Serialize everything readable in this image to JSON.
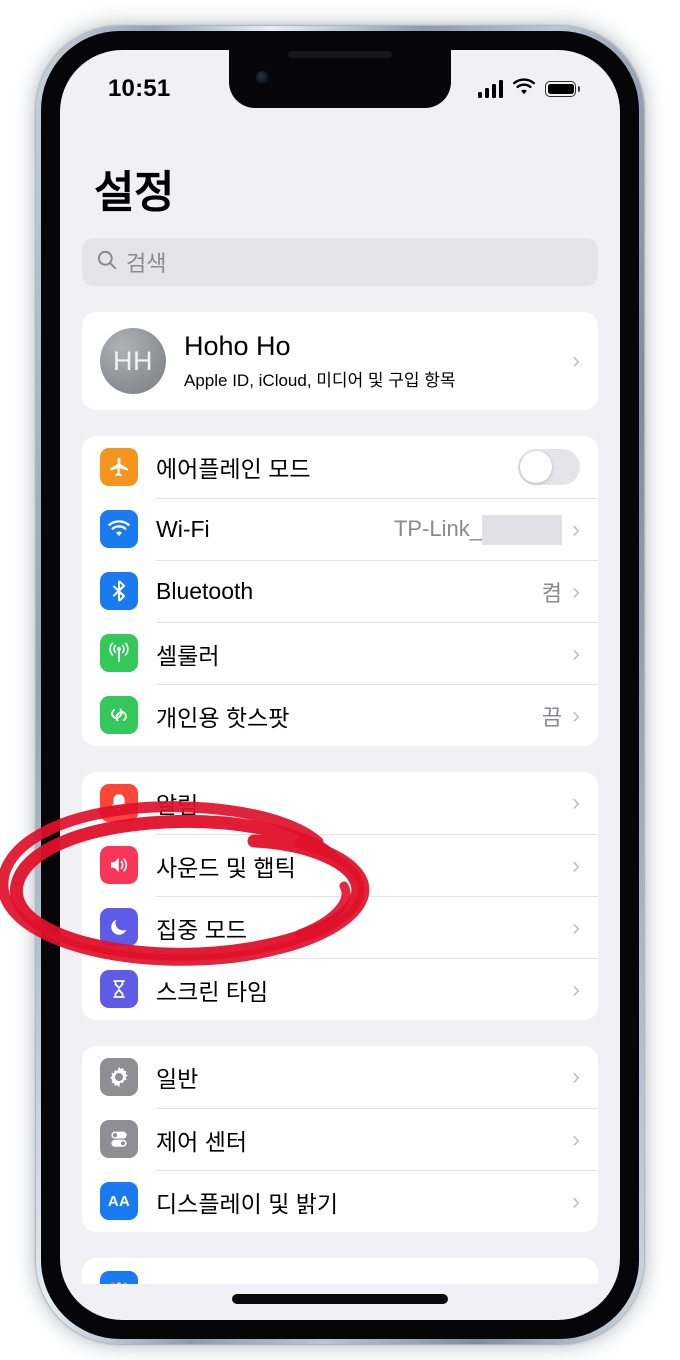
{
  "status_bar": {
    "time": "10:51",
    "signal_icon": "cellular-bars-icon",
    "wifi_icon": "wifi-icon",
    "battery_icon": "battery-full-icon"
  },
  "header": {
    "title": "설정"
  },
  "search": {
    "icon": "search-icon",
    "placeholder": "검색",
    "value": ""
  },
  "apple_id": {
    "initials": "HH",
    "name": "Hoho Ho",
    "subtitle": "Apple ID, iCloud, 미디어 및 구입 항목",
    "chevron": "›"
  },
  "groups": [
    {
      "name": "connectivity",
      "rows": [
        {
          "label": "에어플레인 모드",
          "icon": "airplane-icon",
          "color": "#F59520",
          "control": "toggle",
          "toggle_on": false
        },
        {
          "label": "Wi-Fi",
          "icon": "wifi-icon",
          "color": "#1A7AF0",
          "value": "TP-Link_",
          "redacted": true,
          "chevron": "›"
        },
        {
          "label": "Bluetooth",
          "icon": "bluetooth-icon",
          "color": "#1A7AF0",
          "value": "켬",
          "chevron": "›"
        },
        {
          "label": "셀룰러",
          "icon": "cellular-antenna-icon",
          "color": "#34C759",
          "value": "",
          "chevron": "›"
        },
        {
          "label": "개인용 핫스팟",
          "icon": "hotspot-link-icon",
          "color": "#34C759",
          "value": "끔",
          "chevron": "›"
        }
      ]
    },
    {
      "name": "alerts",
      "rows": [
        {
          "label": "알림",
          "icon": "notification-bell-icon",
          "color": "#FF453A",
          "value": "",
          "chevron": "›"
        },
        {
          "label": "사운드 및 햅틱",
          "icon": "speaker-volume-icon",
          "color": "#F8365A",
          "value": "",
          "chevron": "›"
        },
        {
          "label": "집중 모드",
          "icon": "moon-focus-icon",
          "color": "#5E5CE6",
          "value": "",
          "chevron": "›"
        },
        {
          "label": "스크린 타임",
          "icon": "hourglass-icon",
          "color": "#5E5CE6",
          "value": "",
          "chevron": "›"
        }
      ]
    },
    {
      "name": "system",
      "rows": [
        {
          "label": "일반",
          "icon": "gear-icon",
          "color": "#8E8E93",
          "value": "",
          "chevron": "›"
        },
        {
          "label": "제어 센터",
          "icon": "control-center-toggles-icon",
          "color": "#8E8E93",
          "value": "",
          "chevron": "›"
        },
        {
          "label": "디스플레이 및 밝기",
          "icon": "display-aa-icon",
          "color": "#1A7AF0",
          "value": "",
          "chevron": "›",
          "aa_text": "AA"
        }
      ]
    }
  ],
  "cut_off_row": {
    "icon": "home-screen-grid-icon"
  },
  "annotation": {
    "type": "hand-drawn-ellipse",
    "color": "#E0102A",
    "targets": [
      "알림",
      "사운드 및 햅틱"
    ]
  }
}
